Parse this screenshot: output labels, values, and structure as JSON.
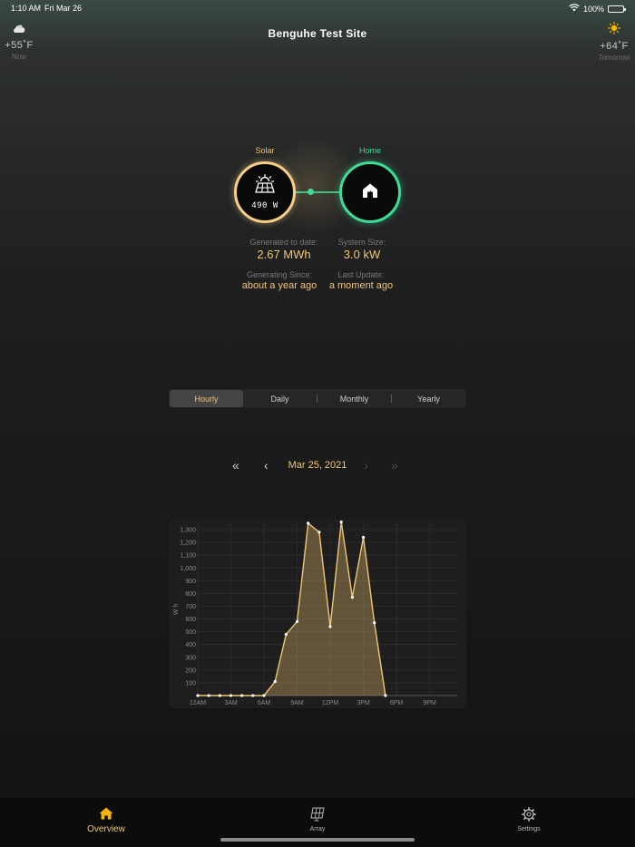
{
  "status_bar": {
    "time": "1:10 AM",
    "date": "Fri Mar 26",
    "battery": "100%"
  },
  "weather": {
    "now": {
      "temp": "+55˚F",
      "label": "Now",
      "icon": "cloud-icon"
    },
    "tomorrow": {
      "temp": "+64˚F",
      "label": "Tomorrow",
      "icon": "sun-icon"
    }
  },
  "site": {
    "title": "Benguhe Test Site"
  },
  "flow": {
    "solar_label": "Solar",
    "solar_power": "490 W",
    "home_label": "Home",
    "solar_color": "#f0c674",
    "home_color": "#3ddc97"
  },
  "stats": {
    "generated_label": "Generated to date:",
    "generated_value": "2.67 MWh",
    "system_size_label": "System Size:",
    "system_size_value": "3.0 kW",
    "since_label": "Generating Since:",
    "since_value": "about a year ago",
    "update_label": "Last Update:",
    "update_value": "a moment ago"
  },
  "period_tabs": {
    "hourly": "Hourly",
    "daily": "Daily",
    "monthly": "Monthly",
    "yearly": "Yearly",
    "selected": "Hourly"
  },
  "date_nav": {
    "date": "Mar 25, 2021"
  },
  "chart_data": {
    "type": "area",
    "ylabel": "Wh",
    "xlabel": "",
    "ylim": [
      0,
      1350
    ],
    "yticks": [
      100,
      200,
      300,
      400,
      500,
      600,
      700,
      800,
      900,
      1000,
      1100,
      1200,
      1300
    ],
    "ytick_labels": [
      "100",
      "200",
      "300",
      "400",
      "500",
      "600",
      "700",
      "800",
      "900",
      "1,000",
      "1,100",
      "1,200",
      "1,300"
    ],
    "xlim": [
      0,
      23.5
    ],
    "xticks": [
      0,
      3,
      6,
      9,
      12,
      15,
      18,
      21
    ],
    "xtick_labels": [
      "12AM",
      "3AM",
      "6AM",
      "9AM",
      "12PM",
      "3PM",
      "6PM",
      "9PM"
    ],
    "grid": true,
    "color": "#f0c674",
    "x": [
      0,
      1,
      2,
      3,
      4,
      5,
      6,
      7,
      8,
      9,
      10,
      11,
      12,
      13,
      14,
      15,
      16,
      17
    ],
    "values": [
      0,
      0,
      0,
      0,
      0,
      0,
      0,
      110,
      480,
      580,
      1350,
      1280,
      540,
      1360,
      770,
      1240,
      570,
      0
    ]
  },
  "tab_bar": {
    "overview": "Overview",
    "array": "Array",
    "settings": "Settings",
    "selected": "Overview"
  }
}
